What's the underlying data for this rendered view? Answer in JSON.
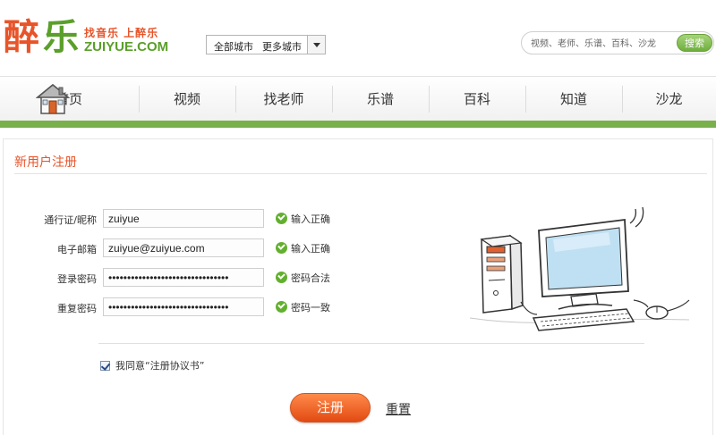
{
  "brand": {
    "logo_char1": "醉",
    "logo_char2": "乐",
    "slogan": "找音乐 上醉乐",
    "domain": "ZUIYUE.COM",
    "colors": {
      "orange": "#e8542a",
      "green": "#5a9f2a",
      "nav_bar": "#7ab04b"
    }
  },
  "city_selector": {
    "current": "全部城市",
    "more": "更多城市"
  },
  "search": {
    "placeholder": "视频、老师、乐谱、百科、沙龙",
    "button_label": "搜索"
  },
  "nav": {
    "items": [
      {
        "label": "首页",
        "icon": "home-icon"
      },
      {
        "label": "视频"
      },
      {
        "label": "找老师"
      },
      {
        "label": "乐谱"
      },
      {
        "label": "百科"
      },
      {
        "label": "知道"
      },
      {
        "label": "沙龙"
      }
    ]
  },
  "page": {
    "title": "新用户注册"
  },
  "form": {
    "fields": [
      {
        "label": "通行证/昵称",
        "value": "zuiyue",
        "type": "text",
        "status": "输入正确"
      },
      {
        "label": "电子邮箱",
        "value": "zuiyue@zuiyue.com",
        "type": "text",
        "status": "输入正确"
      },
      {
        "label": "登录密码",
        "value": "********************************",
        "type": "password",
        "status": "密码合法"
      },
      {
        "label": "重复密码",
        "value": "********************************",
        "type": "password",
        "status": "密码一致"
      }
    ],
    "agreement_label": "我同意“注册协议书”",
    "agreement_checked": true,
    "register_button": "注册",
    "reset_link": "重置"
  },
  "illustration": {
    "icon": "computer-illustration"
  }
}
